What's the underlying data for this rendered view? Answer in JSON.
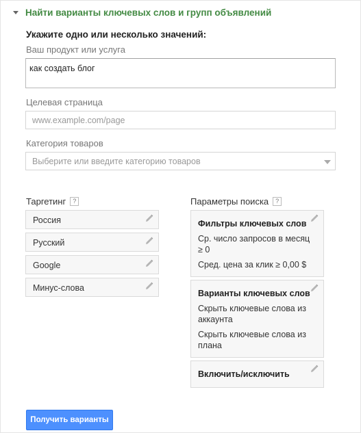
{
  "section": {
    "title": "Найти варианты ключевых слов и групп объявлений"
  },
  "form": {
    "instructions": "Укажите одно или несколько значений:",
    "product_label": "Ваш продукт или услуга",
    "product_value": "как создать блог",
    "landing_label": "Целевая страница",
    "landing_placeholder": "www.example.com/page",
    "category_label": "Категория товаров",
    "category_placeholder": "Выберите или введите категорию товаров"
  },
  "targeting": {
    "title": "Таргетинг",
    "help": "?",
    "items": [
      {
        "label": "Россия"
      },
      {
        "label": "Русский"
      },
      {
        "label": "Google"
      },
      {
        "label": "Минус-слова"
      }
    ]
  },
  "search_params": {
    "title": "Параметры поиска",
    "help": "?",
    "cards": [
      {
        "title": "Фильтры ключевых слов",
        "lines": [
          "Ср. число запросов в месяц ≥ 0",
          "Сред. цена за клик ≥ 0,00 $"
        ]
      },
      {
        "title": "Варианты ключевых слов",
        "lines": [
          "Скрыть ключевые слова из аккаунта",
          "Скрыть ключевые слова из плана"
        ]
      },
      {
        "title": "Включить/исключить",
        "lines": []
      }
    ]
  },
  "submit_label": "Получить варианты",
  "icons": {
    "collapse": "triangle-down-icon",
    "edit": "pencil-icon",
    "help": "help-icon"
  }
}
